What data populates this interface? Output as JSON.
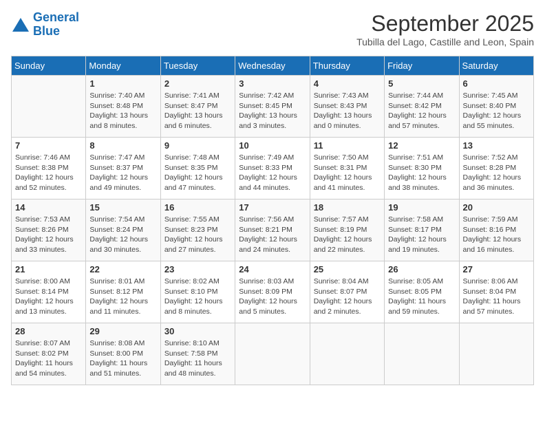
{
  "header": {
    "logo_line1": "General",
    "logo_line2": "Blue",
    "month": "September 2025",
    "location": "Tubilla del Lago, Castille and Leon, Spain"
  },
  "weekdays": [
    "Sunday",
    "Monday",
    "Tuesday",
    "Wednesday",
    "Thursday",
    "Friday",
    "Saturday"
  ],
  "weeks": [
    [
      {
        "day": "",
        "info": ""
      },
      {
        "day": "1",
        "info": "Sunrise: 7:40 AM\nSunset: 8:48 PM\nDaylight: 13 hours\nand 8 minutes."
      },
      {
        "day": "2",
        "info": "Sunrise: 7:41 AM\nSunset: 8:47 PM\nDaylight: 13 hours\nand 6 minutes."
      },
      {
        "day": "3",
        "info": "Sunrise: 7:42 AM\nSunset: 8:45 PM\nDaylight: 13 hours\nand 3 minutes."
      },
      {
        "day": "4",
        "info": "Sunrise: 7:43 AM\nSunset: 8:43 PM\nDaylight: 13 hours\nand 0 minutes."
      },
      {
        "day": "5",
        "info": "Sunrise: 7:44 AM\nSunset: 8:42 PM\nDaylight: 12 hours\nand 57 minutes."
      },
      {
        "day": "6",
        "info": "Sunrise: 7:45 AM\nSunset: 8:40 PM\nDaylight: 12 hours\nand 55 minutes."
      }
    ],
    [
      {
        "day": "7",
        "info": "Sunrise: 7:46 AM\nSunset: 8:38 PM\nDaylight: 12 hours\nand 52 minutes."
      },
      {
        "day": "8",
        "info": "Sunrise: 7:47 AM\nSunset: 8:37 PM\nDaylight: 12 hours\nand 49 minutes."
      },
      {
        "day": "9",
        "info": "Sunrise: 7:48 AM\nSunset: 8:35 PM\nDaylight: 12 hours\nand 47 minutes."
      },
      {
        "day": "10",
        "info": "Sunrise: 7:49 AM\nSunset: 8:33 PM\nDaylight: 12 hours\nand 44 minutes."
      },
      {
        "day": "11",
        "info": "Sunrise: 7:50 AM\nSunset: 8:31 PM\nDaylight: 12 hours\nand 41 minutes."
      },
      {
        "day": "12",
        "info": "Sunrise: 7:51 AM\nSunset: 8:30 PM\nDaylight: 12 hours\nand 38 minutes."
      },
      {
        "day": "13",
        "info": "Sunrise: 7:52 AM\nSunset: 8:28 PM\nDaylight: 12 hours\nand 36 minutes."
      }
    ],
    [
      {
        "day": "14",
        "info": "Sunrise: 7:53 AM\nSunset: 8:26 PM\nDaylight: 12 hours\nand 33 minutes."
      },
      {
        "day": "15",
        "info": "Sunrise: 7:54 AM\nSunset: 8:24 PM\nDaylight: 12 hours\nand 30 minutes."
      },
      {
        "day": "16",
        "info": "Sunrise: 7:55 AM\nSunset: 8:23 PM\nDaylight: 12 hours\nand 27 minutes."
      },
      {
        "day": "17",
        "info": "Sunrise: 7:56 AM\nSunset: 8:21 PM\nDaylight: 12 hours\nand 24 minutes."
      },
      {
        "day": "18",
        "info": "Sunrise: 7:57 AM\nSunset: 8:19 PM\nDaylight: 12 hours\nand 22 minutes."
      },
      {
        "day": "19",
        "info": "Sunrise: 7:58 AM\nSunset: 8:17 PM\nDaylight: 12 hours\nand 19 minutes."
      },
      {
        "day": "20",
        "info": "Sunrise: 7:59 AM\nSunset: 8:16 PM\nDaylight: 12 hours\nand 16 minutes."
      }
    ],
    [
      {
        "day": "21",
        "info": "Sunrise: 8:00 AM\nSunset: 8:14 PM\nDaylight: 12 hours\nand 13 minutes."
      },
      {
        "day": "22",
        "info": "Sunrise: 8:01 AM\nSunset: 8:12 PM\nDaylight: 12 hours\nand 11 minutes."
      },
      {
        "day": "23",
        "info": "Sunrise: 8:02 AM\nSunset: 8:10 PM\nDaylight: 12 hours\nand 8 minutes."
      },
      {
        "day": "24",
        "info": "Sunrise: 8:03 AM\nSunset: 8:09 PM\nDaylight: 12 hours\nand 5 minutes."
      },
      {
        "day": "25",
        "info": "Sunrise: 8:04 AM\nSunset: 8:07 PM\nDaylight: 12 hours\nand 2 minutes."
      },
      {
        "day": "26",
        "info": "Sunrise: 8:05 AM\nSunset: 8:05 PM\nDaylight: 11 hours\nand 59 minutes."
      },
      {
        "day": "27",
        "info": "Sunrise: 8:06 AM\nSunset: 8:04 PM\nDaylight: 11 hours\nand 57 minutes."
      }
    ],
    [
      {
        "day": "28",
        "info": "Sunrise: 8:07 AM\nSunset: 8:02 PM\nDaylight: 11 hours\nand 54 minutes."
      },
      {
        "day": "29",
        "info": "Sunrise: 8:08 AM\nSunset: 8:00 PM\nDaylight: 11 hours\nand 51 minutes."
      },
      {
        "day": "30",
        "info": "Sunrise: 8:10 AM\nSunset: 7:58 PM\nDaylight: 11 hours\nand 48 minutes."
      },
      {
        "day": "",
        "info": ""
      },
      {
        "day": "",
        "info": ""
      },
      {
        "day": "",
        "info": ""
      },
      {
        "day": "",
        "info": ""
      }
    ]
  ]
}
